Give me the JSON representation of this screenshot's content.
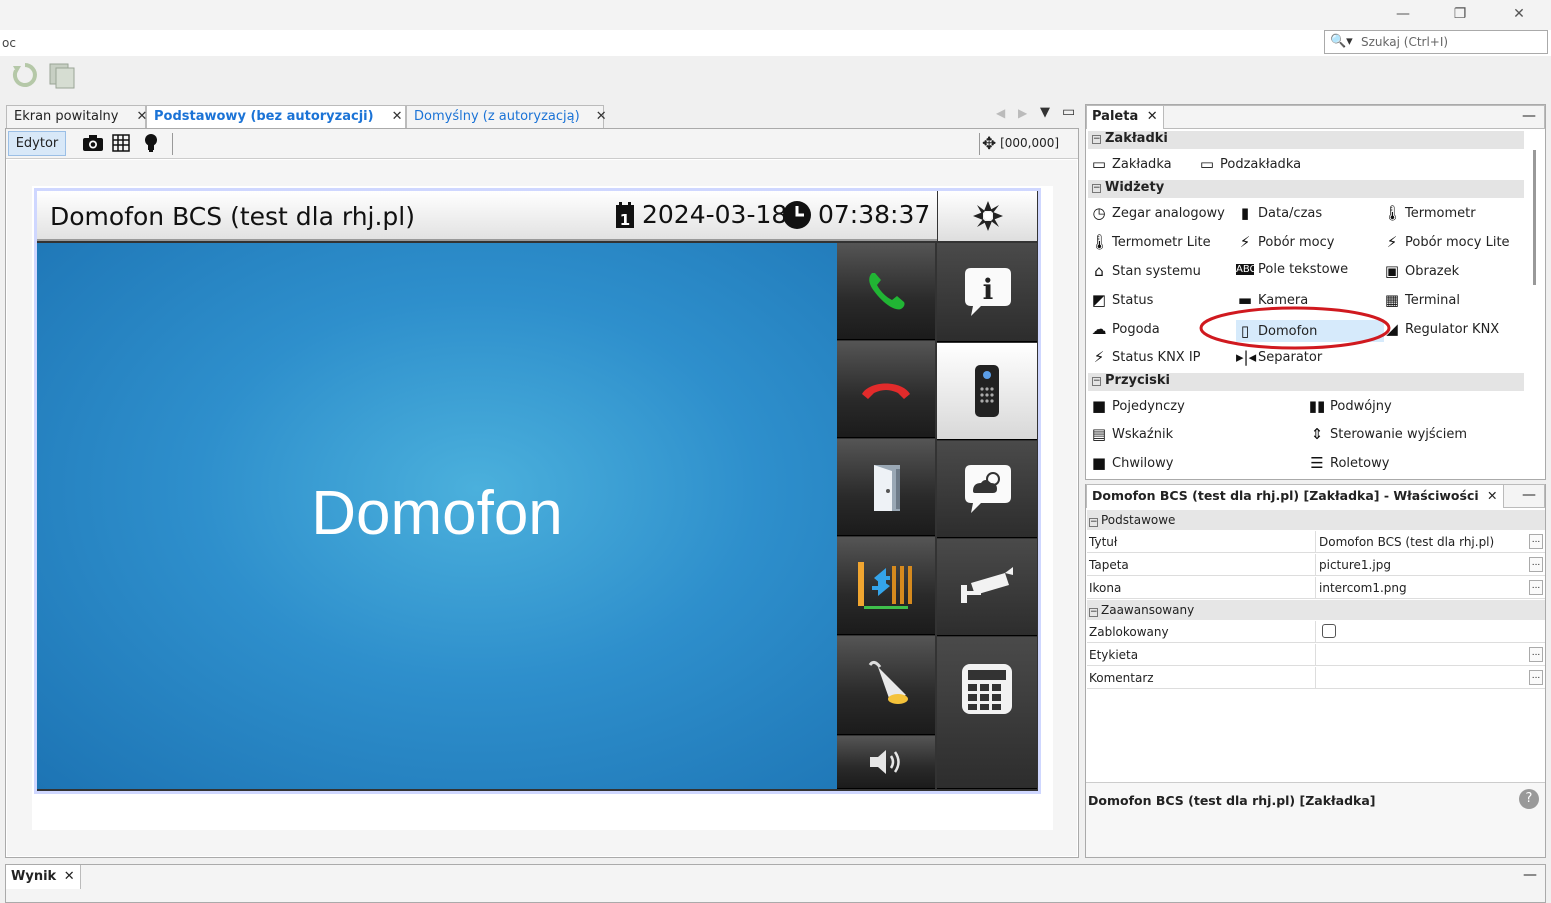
{
  "app": {
    "name": "oc"
  },
  "search": {
    "placeholder": "Szukaj (Ctrl+I)"
  },
  "doc_tabs": [
    {
      "label": "Ekran powitalny"
    },
    {
      "label": "Podstawowy (bez autoryzacji)"
    },
    {
      "label": "Domyślny (z autoryzacją)"
    }
  ],
  "editor": {
    "mode_label": "Edytor",
    "coords": "[000,000]"
  },
  "screen": {
    "title": "Domofon BCS (test dla rhj.pl)",
    "date": "2024-03-18",
    "time": "07:38:37",
    "label": "Domofon"
  },
  "palette": {
    "tab": "Paleta",
    "sections": {
      "tabs": {
        "title": "Zakładki",
        "items": [
          "Zakładka",
          "Podzakładka"
        ]
      },
      "widgets": {
        "title": "Widżety",
        "items": [
          "Zegar analogowy",
          "Data/czas",
          "Termometr",
          "Termometr Lite",
          "Pobór mocy",
          "Pobór mocy Lite",
          "Stan systemu",
          "Pole tekstowe",
          "Obrazek",
          "Status",
          "Kamera",
          "Terminal",
          "Pogoda",
          "Domofon",
          "Regulator KNX",
          "Status KNX IP",
          "Separator"
        ]
      },
      "buttons": {
        "title": "Przyciski",
        "items": [
          "Pojedynczy",
          "Podwójny",
          "Wskaźnik",
          "Sterowanie wyjściem",
          "Chwilowy",
          "Roletowy"
        ]
      }
    },
    "highlight_color": "#d0191f"
  },
  "properties": {
    "tab": "Domofon BCS (test dla rhj.pl) [Zakładka] - Właściwości",
    "groups": {
      "basic": "Podstawowe",
      "advanced": "Zaawansowany"
    },
    "rows": {
      "title": {
        "key": "Tytuł",
        "value": "Domofon BCS (test dla rhj.pl)"
      },
      "wallpaper": {
        "key": "Tapeta",
        "value": "picture1.jpg"
      },
      "icon": {
        "key": "Ikona",
        "value": "intercom1.png"
      },
      "locked": {
        "key": "Zablokowany",
        "value": ""
      },
      "label": {
        "key": "Etykieta",
        "value": ""
      },
      "comment": {
        "key": "Komentarz",
        "value": ""
      }
    },
    "footer": "Domofon BCS (test dla rhj.pl) [Zakładka]"
  },
  "output": {
    "tab": "Wynik"
  }
}
